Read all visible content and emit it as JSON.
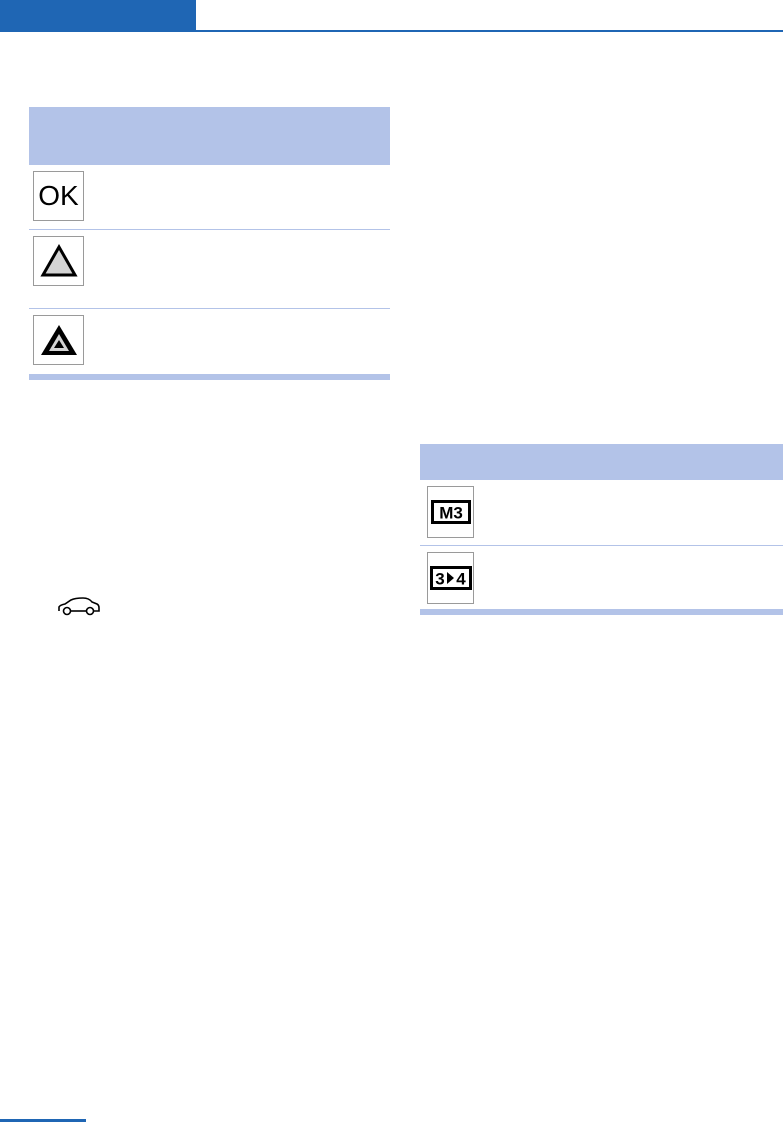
{
  "colors": {
    "accent": "#1f66b4",
    "table_header": "#b3c3e8"
  },
  "left_table": {
    "rows": [
      {
        "icon": "ok-icon",
        "icon_text": "OK"
      },
      {
        "icon": "warning-triangle-outline-icon"
      },
      {
        "icon": "warning-triangle-filled-icon"
      }
    ]
  },
  "right_table": {
    "rows": [
      {
        "icon": "manual-gear-m3-icon",
        "icon_text": "M3"
      },
      {
        "icon": "gear-shift-3-to-4-icon",
        "icon_text_from": "3",
        "icon_text_to": "4"
      }
    ]
  },
  "inline_icon": "car-icon"
}
